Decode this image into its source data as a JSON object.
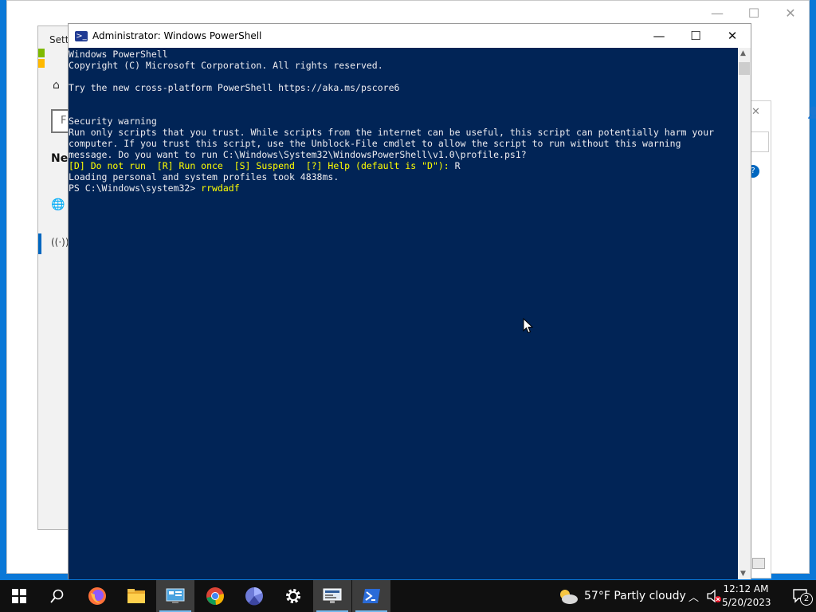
{
  "background_window": {
    "controls": [
      "—",
      "☐",
      "✕"
    ]
  },
  "settings_window": {
    "title": "Setti",
    "search_placeholder": "F",
    "nav_header": "Net"
  },
  "powershell": {
    "title": "Administrator: Windows PowerShell",
    "controls": {
      "minimize": "—",
      "maximize": "☐",
      "close": "✕"
    },
    "console_lines": [
      "Windows PowerShell",
      "Copyright (C) Microsoft Corporation. All rights reserved.",
      "",
      "Try the new cross-platform PowerShell https://aka.ms/pscore6",
      "",
      "",
      "Security warning",
      "Run only scripts that you trust. While scripts from the internet can be useful, this script can potentially harm your",
      "computer. If you trust this script, use the Unblock-File cmdlet to allow the script to run without this warning",
      "message. Do you want to run C:\\Windows\\System32\\WindowsPowerShell\\v1.0\\profile.ps1?"
    ],
    "prompt_options": "[D] Do not run  [R] Run once  [S] Suspend  [?] Help (default is \"D\"):",
    "prompt_answer": " R",
    "profile_line": "Loading personal and system profiles took 4838ms.",
    "prompt": "PS C:\\Windows\\system32> ",
    "typed_command": "rrwdadf",
    "colors": {
      "background": "#012456",
      "text": "#eeedf0",
      "highlight": "#ffff00"
    }
  },
  "taskbar": {
    "apps": [
      {
        "name": "start",
        "icon": "windows-logo-icon"
      },
      {
        "name": "search",
        "icon": "search-icon"
      },
      {
        "name": "firefox",
        "icon": "firefox-icon"
      },
      {
        "name": "file-explorer",
        "icon": "folder-icon"
      },
      {
        "name": "control-panel",
        "icon": "control-panel-icon"
      },
      {
        "name": "chrome",
        "icon": "chrome-icon"
      },
      {
        "name": "app",
        "icon": "app-icon"
      },
      {
        "name": "settings",
        "icon": "gear-icon"
      },
      {
        "name": "network-app",
        "icon": "network-icon"
      },
      {
        "name": "powershell",
        "icon": "powershell-icon"
      }
    ],
    "weather": {
      "temp": "57°F",
      "condition": "Partly cloudy"
    },
    "clock": {
      "time": "12:12 AM",
      "date": "5/20/2023"
    },
    "notification_count": "2"
  }
}
